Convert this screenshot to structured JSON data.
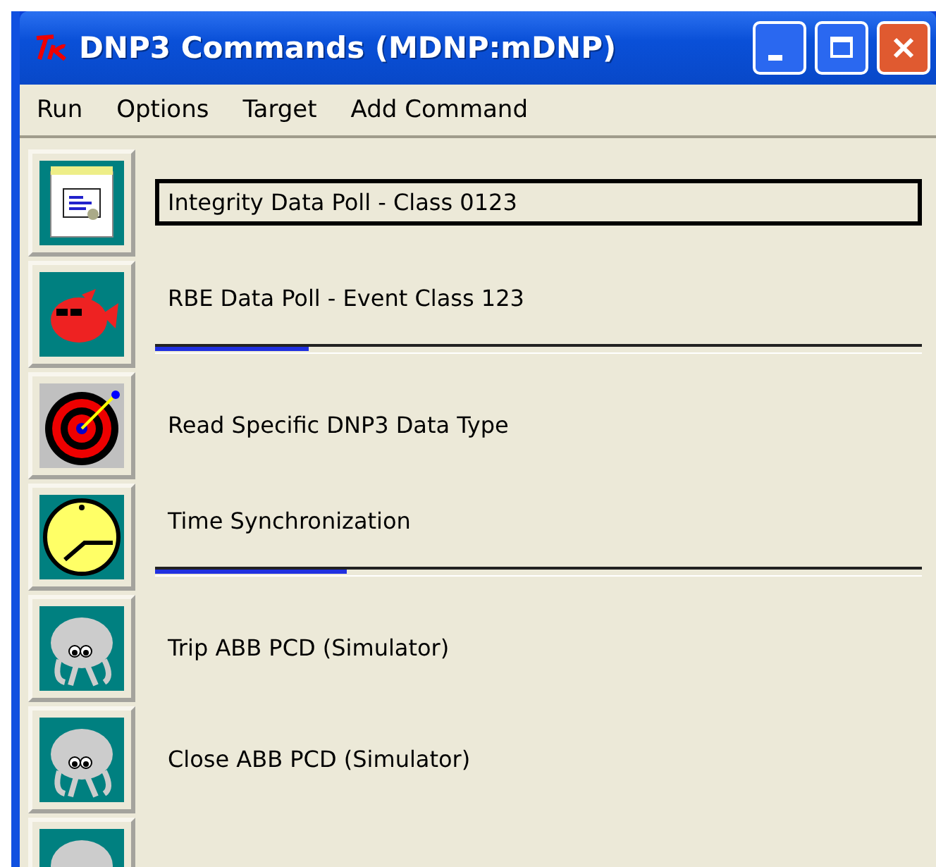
{
  "window": {
    "title": "DNP3 Commands (MDNP:mDNP)"
  },
  "menu": [
    "Run",
    "Options",
    "Target",
    "Add Command"
  ],
  "commands": [
    {
      "kind": "certificate",
      "label": "Integrity Data Poll - Class 0123",
      "focused": true
    },
    {
      "kind": "fish",
      "label": "RBE Data Poll - Event Class 123",
      "focused": false,
      "level": 0.2
    },
    {
      "kind": "target",
      "label": "Read Specific DNP3 Data Type",
      "focused": false
    },
    {
      "kind": "clock",
      "label": "Time Synchronization",
      "focused": false,
      "level": 0.25
    },
    {
      "kind": "bug",
      "label": "Trip ABB PCD (Simulator)",
      "focused": false
    },
    {
      "kind": "bug",
      "label": "Close ABB PCD (Simulator)",
      "focused": false
    },
    {
      "kind": "bug"
    }
  ]
}
